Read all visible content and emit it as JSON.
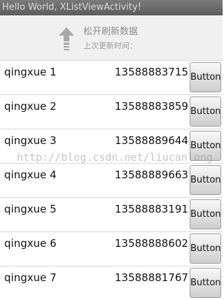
{
  "window": {
    "title": "Hello World, XListViewActivity!"
  },
  "refresh_header": {
    "pull_text": "松开刷新数据",
    "last_update_label": "上次更新时间：",
    "arrow_icon": "up-arrow-icon"
  },
  "list": {
    "items": [
      {
        "name": "qingxue 1",
        "phone": "13588883715",
        "button_label": "Button"
      },
      {
        "name": "qingxue 2",
        "phone": "13588883859",
        "button_label": "Button"
      },
      {
        "name": "qingxue 3",
        "phone": "13588889644",
        "button_label": "Button"
      },
      {
        "name": "qingxue 4",
        "phone": "13588889663",
        "button_label": "Button"
      },
      {
        "name": "qingxue 5",
        "phone": "13588883191",
        "button_label": "Button"
      },
      {
        "name": "qingxue 6",
        "phone": "13588888602",
        "button_label": "Button"
      },
      {
        "name": "qingxue 7",
        "phone": "13588881767",
        "button_label": "Button"
      }
    ]
  },
  "watermark": "http://blog.csdn.net/liucanlong",
  "colors": {
    "titlebar": "#6b6b6b",
    "header_bg": "#f0f0f0",
    "divider": "#d8d8d8"
  }
}
